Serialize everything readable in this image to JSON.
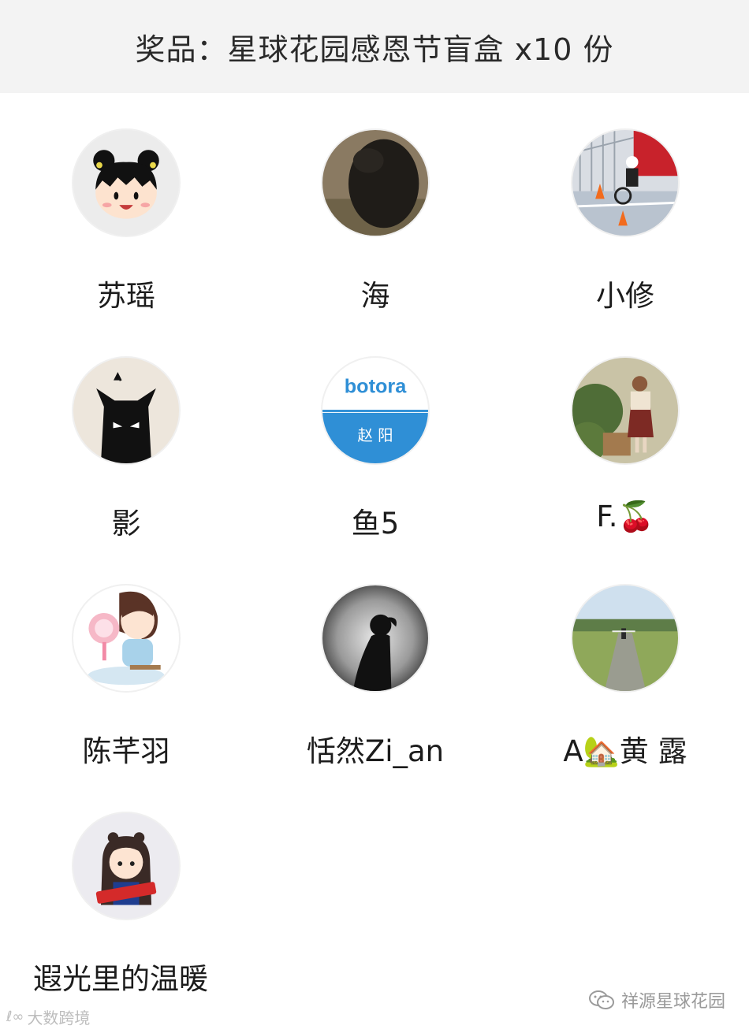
{
  "header": {
    "title": "奖品：星球花园感恩节盲盒 x10 份"
  },
  "winners": [
    {
      "name": "苏瑶",
      "avatar_icon": "cartoon-girl-avatar-icon"
    },
    {
      "name": "海",
      "avatar_icon": "dark-animal-photo-avatar-icon"
    },
    {
      "name": "小修",
      "avatar_icon": "child-cycling-photo-avatar-icon"
    },
    {
      "name": "影",
      "avatar_icon": "black-cat-avatar-icon"
    },
    {
      "name": "鱼5",
      "avatar_icon": "botora-logo-avatar-icon",
      "logo_text": "botora",
      "logo_subtext": "赵 阳"
    },
    {
      "name": "F.🍒",
      "avatar_icon": "girl-garden-photo-avatar-icon"
    },
    {
      "name": "陈芊羽",
      "avatar_icon": "cartoon-girl-fan-avatar-icon"
    },
    {
      "name": "恬然Zi_an",
      "avatar_icon": "silhouette-avatar-icon"
    },
    {
      "name": "A🏡黄 露",
      "avatar_icon": "field-path-photo-avatar-icon"
    },
    {
      "name": "遐光里的温暖",
      "avatar_icon": "cartoon-girl-banner-avatar-icon"
    }
  ],
  "watermarks": {
    "left": "大数跨境",
    "right": "祥源星球花园"
  }
}
